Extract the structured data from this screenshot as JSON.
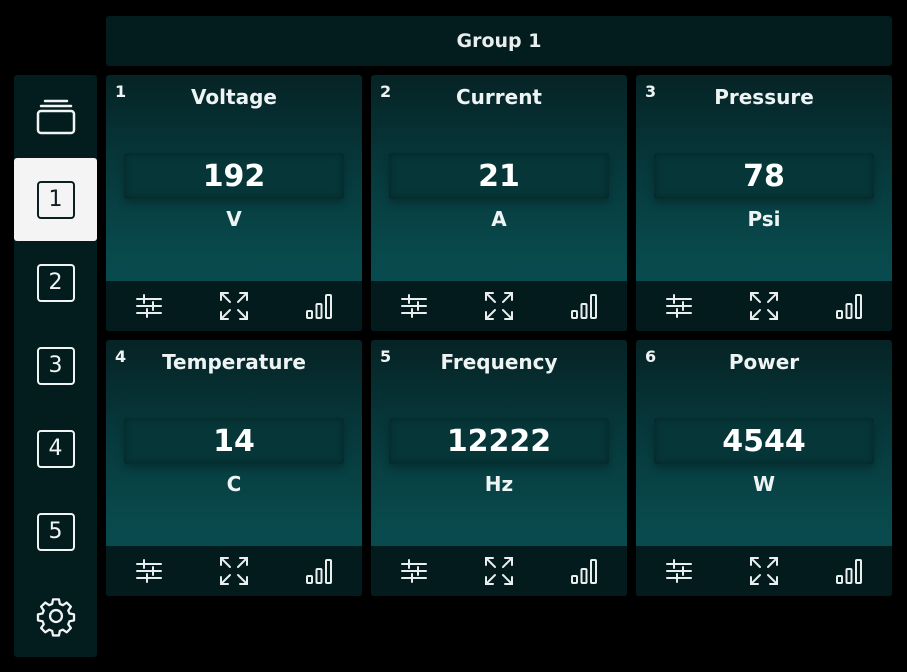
{
  "header": {
    "title": "Group 1"
  },
  "sidebar": {
    "items": [
      {
        "icon": "stack-icon",
        "label": ""
      },
      {
        "label": "1",
        "active": true
      },
      {
        "label": "2"
      },
      {
        "label": "3"
      },
      {
        "label": "4"
      },
      {
        "label": "5"
      },
      {
        "icon": "gear-icon",
        "label": ""
      }
    ]
  },
  "cards": [
    {
      "index": "1",
      "title": "Voltage",
      "value": "192",
      "unit": "V"
    },
    {
      "index": "2",
      "title": "Current",
      "value": "21",
      "unit": "A"
    },
    {
      "index": "3",
      "title": "Pressure",
      "value": "78",
      "unit": "Psi"
    },
    {
      "index": "4",
      "title": "Temperature",
      "value": "14",
      "unit": "C"
    },
    {
      "index": "5",
      "title": "Frequency",
      "value": "12222",
      "unit": "Hz"
    },
    {
      "index": "6",
      "title": "Power",
      "value": "4544",
      "unit": "W"
    }
  ],
  "footer_icons": [
    "sliders-icon",
    "expand-icon",
    "signal-bars-icon"
  ],
  "colors": {
    "background": "#000000",
    "panel": "#031c1e",
    "card_gradient_top": "#062325",
    "card_gradient_bottom": "#094f52",
    "text": "#eef3f3",
    "active_item": "#f4f4f4"
  }
}
